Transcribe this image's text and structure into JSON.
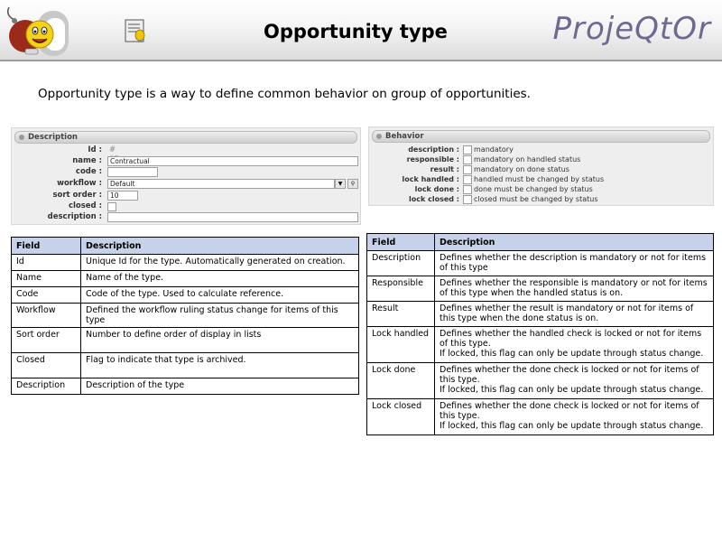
{
  "header": {
    "title": "Opportunity type",
    "brand": "ProjeQtOr"
  },
  "intro": "Opportunity type is a way to define common behavior on group of opportunities.",
  "description_panel": {
    "title": "Description",
    "id_label": "Id :",
    "id_value": "# 87",
    "name_label": "name :",
    "name_value": "Contractual",
    "code_label": "code :",
    "code_value": "",
    "workflow_label": "workflow :",
    "workflow_value": "Default",
    "sort_order_label": "sort order :",
    "sort_order_value": "10",
    "closed_label": "closed :",
    "description_label": "description :",
    "description_value": ""
  },
  "behavior_panel": {
    "title": "Behavior",
    "rows": [
      {
        "label": "description :",
        "text": "mandatory"
      },
      {
        "label": "responsible :",
        "text": "mandatory on handled status"
      },
      {
        "label": "result :",
        "text": "mandatory on done status"
      },
      {
        "label": "lock handled :",
        "text": "handled must be changed by status"
      },
      {
        "label": "lock done :",
        "text": "done must be changed by status"
      },
      {
        "label": "lock closed :",
        "text": "closed must be changed by status"
      }
    ]
  },
  "left_table": {
    "headers": [
      "Field",
      "Description"
    ],
    "rows": [
      [
        "Id",
        "Unique Id for the type. Automatically generated on creation."
      ],
      [
        "Name",
        "Name of the type."
      ],
      [
        "Code",
        "Code of the type. Used to calculate reference."
      ],
      [
        "Workflow",
        "Defined the workflow ruling status change for items of this type"
      ],
      [
        "Sort order",
        "Number to define order of display in lists"
      ],
      [
        "Closed",
        "Flag to indicate that type is archived."
      ],
      [
        "Description",
        "Description of the type"
      ]
    ]
  },
  "right_table": {
    "headers": [
      "Field",
      "Description"
    ],
    "rows": [
      {
        "field": "Description",
        "desc": "Defines whether the description is mandatory or not for items of this type",
        "note": ""
      },
      {
        "field": "Responsible",
        "desc": "Defines whether the responsible is mandatory or not for items of this type when the handled status is on.",
        "note": ""
      },
      {
        "field": "Result",
        "desc": "Defines whether the result is mandatory or not for items of this type when the done status is on.",
        "note": ""
      },
      {
        "field": "Lock handled",
        "desc": "Defines whether the handled check is locked or not for items of this type.",
        "note": "If locked, this flag can only be update through status change."
      },
      {
        "field": "Lock done",
        "desc": "Defines whether the done check is locked or not for items of this type.",
        "note": "If locked, this flag can only be update through status change."
      },
      {
        "field": "Lock closed",
        "desc": "Defines whether the done check is locked or not for items of this type.",
        "note": "If locked, this flag can only be update through status change."
      }
    ]
  }
}
